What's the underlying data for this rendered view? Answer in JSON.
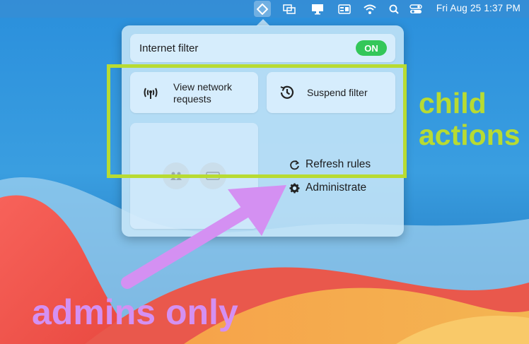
{
  "menubar": {
    "icons": [
      "filter-icon",
      "window-icon",
      "display-icon",
      "card-icon",
      "wifi-icon",
      "search-icon",
      "control-center-icon"
    ],
    "datetime": "Fri Aug 25  1:37 PM"
  },
  "popover": {
    "internet_filter_label": "Internet filter",
    "toggle_label": "ON",
    "view_network_requests": "View network requests",
    "suspend_filter": "Suspend filter",
    "refresh_rules": "Refresh rules",
    "administrate": "Administrate"
  },
  "annotations": {
    "child_line1": "child",
    "child_line2": "actions",
    "admins_only": "admins only"
  },
  "colors": {
    "annotation_green": "#b8db32",
    "annotation_purple": "#d490f2",
    "toggle_on": "#34c759"
  }
}
